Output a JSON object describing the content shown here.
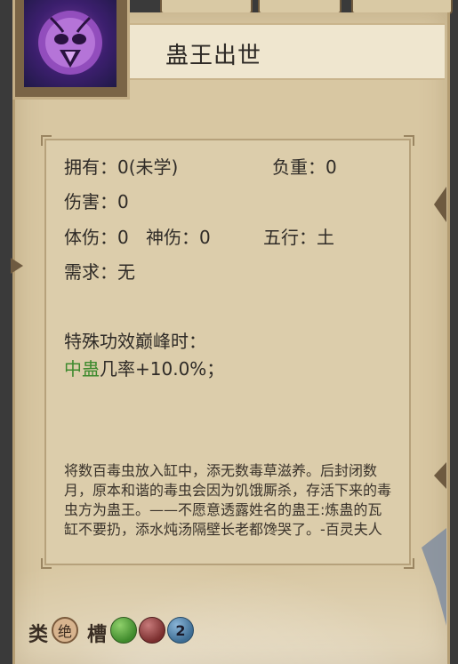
{
  "skill": {
    "title": "蛊王出世",
    "icon": "insect-emblem-icon"
  },
  "stats": {
    "owned": "拥有：0(未学)",
    "weight": "负重：0",
    "damage": "伤害：0",
    "body_damage": "体伤：0",
    "spirit_damage": "神伤：0",
    "element": "五行：土",
    "requirement": "需求：无"
  },
  "special": {
    "heading": "特殊功效巅峰时：",
    "effect_keyword": "中蛊",
    "effect_rest": "几率+10.0%；"
  },
  "description": "将数百毒虫放入缸中，添无数毒草滋养。后封闭数月，原本和谐的毒虫会因为饥饿厮杀，存活下来的毒虫方为蛊王。——不愿意透露姓名的蛊王:炼蛊的瓦缸不要扔，添水炖汤隔壁长老都馋哭了。-百灵夫人",
  "bottom": {
    "category_label": "类",
    "category_badge": "绝",
    "slot_label": "槽",
    "slot_count": "2",
    "colors": {
      "green_slot": "#4f9a3a",
      "red_slot": "#8a3a3a",
      "blue_slot": "#3d6c93",
      "badge_bg": "#d8b48e"
    }
  }
}
